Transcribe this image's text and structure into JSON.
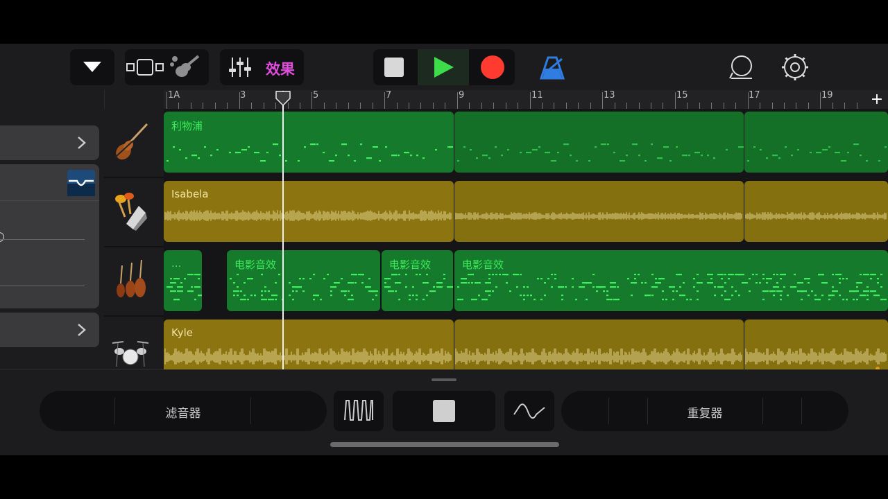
{
  "toolbar": {
    "effects_label": "效果"
  },
  "ruler": {
    "bars": [
      "1A",
      "3",
      "5",
      "7",
      "9",
      "11",
      "13",
      "15",
      "17",
      "19"
    ],
    "add_label": "+"
  },
  "tracks": [
    {
      "instrument": "violin-icon",
      "regions": [
        {
          "label": "利物浦"
        },
        {
          "label": ""
        },
        {
          "label": ""
        }
      ]
    },
    {
      "instrument": "percussion-icon",
      "regions": [
        {
          "label": "Isabela"
        },
        {
          "label": ""
        },
        {
          "label": ""
        }
      ]
    },
    {
      "instrument": "strings-icon",
      "regions": [
        {
          "label": "..."
        },
        {
          "label": "电影音效"
        },
        {
          "label": "电影音效"
        },
        {
          "label": "电影音效"
        }
      ]
    },
    {
      "instrument": "drums-icon",
      "regions": [
        {
          "label": "Kyle"
        },
        {
          "label": ""
        },
        {
          "label": ""
        }
      ]
    }
  ],
  "bottom": {
    "filter_label": "滤音器",
    "repeater_label": "重复器"
  },
  "colors": {
    "midi_region": "#157a2b",
    "audio_region": "#8c7510",
    "effects": "#e04ddc",
    "play": "#3ddc4a",
    "record": "#ff3b30",
    "metronome": "#2f7de1"
  }
}
